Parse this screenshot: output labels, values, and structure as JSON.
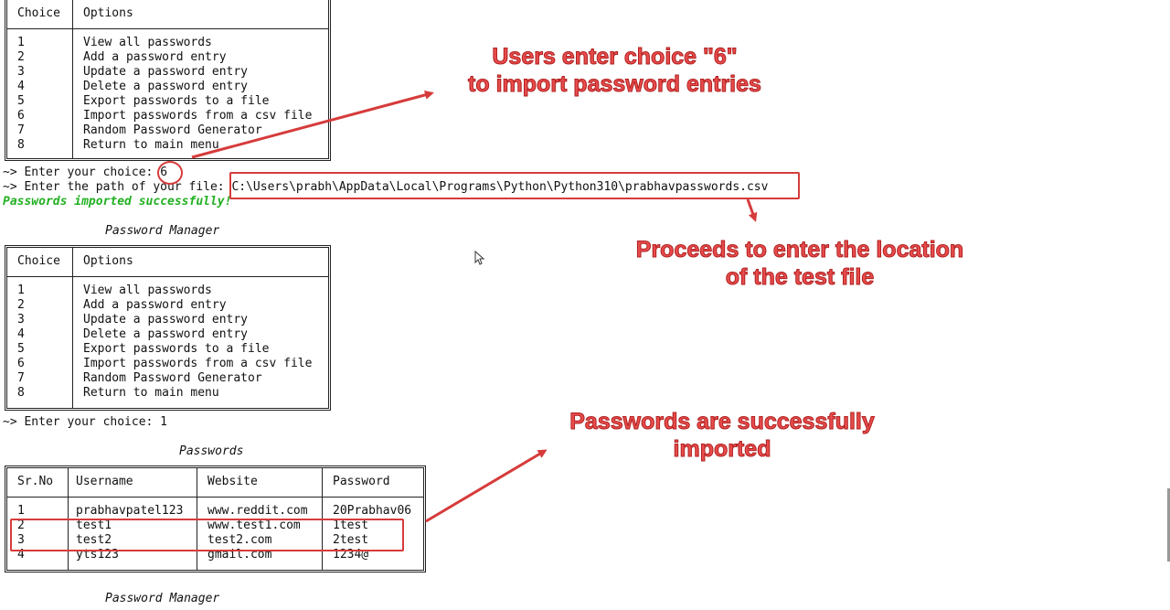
{
  "menu": {
    "header_choice": "Choice",
    "header_options": "Options",
    "items": [
      {
        "num": "1",
        "label": "View all passwords"
      },
      {
        "num": "2",
        "label": "Add a password entry"
      },
      {
        "num": "3",
        "label": "Update a password entry"
      },
      {
        "num": "4",
        "label": "Delete a password entry"
      },
      {
        "num": "5",
        "label": "Export passwords to a file"
      },
      {
        "num": "6",
        "label": "Import passwords from a csv file"
      },
      {
        "num": "7",
        "label": "Random Password Generator"
      },
      {
        "num": "8",
        "label": "Return to main menu"
      }
    ]
  },
  "session": {
    "prompt_choice_1_text": "~> Enter your choice: ",
    "prompt_choice_1_value": "6",
    "prompt_path_text": "~> Enter the path of your file: ",
    "prompt_path_value": "C:\\Users\\prabh\\AppData\\Local\\Programs\\Python\\Python310\\prabhavpasswords.csv",
    "success_message": "Passwords imported successfully!",
    "section_title_manager": "Password Manager",
    "prompt_choice_2": "~> Enter your choice: 1",
    "section_title_passwords": "Passwords",
    "section_title_manager_bottom": "Password Manager"
  },
  "passwords_table": {
    "headers": [
      "Sr.No",
      "Username",
      "Website",
      "Password"
    ],
    "rows": [
      [
        "1",
        "prabhavpatel123",
        "www.reddit.com",
        "20Prabhav06"
      ],
      [
        "2",
        "test1",
        "www.test1.com",
        "1test"
      ],
      [
        "3",
        "test2",
        "test2.com",
        "2test"
      ],
      [
        "4",
        "yts123",
        "gmail.com",
        "1234@"
      ]
    ]
  },
  "annotations": {
    "import_choice": "Users enter choice \"6\"\nto import password entries",
    "file_location": "Proceeds to enter the location\nof the test file",
    "imported": "Passwords are successfully\nimported"
  },
  "colors": {
    "annotation_red": "#e84c4c",
    "success_green": "#22b022"
  }
}
